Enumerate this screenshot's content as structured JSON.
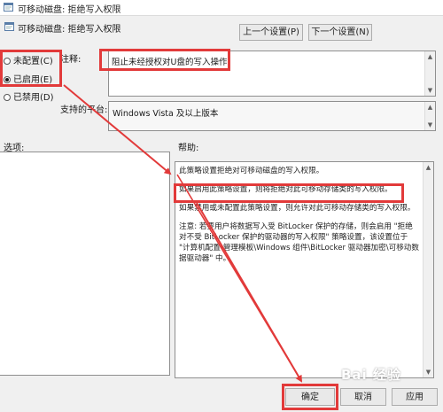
{
  "window": {
    "title": "可移动磁盘: 拒绝写入权限"
  },
  "header": {
    "setting_name": "可移动磁盘: 拒绝写入权限"
  },
  "nav": {
    "prev_label": "上一个设置(P)",
    "next_label": "下一个设置(N)"
  },
  "options": [
    {
      "label": "未配置(C)",
      "selected": false
    },
    {
      "label": "已启用(E)",
      "selected": true
    },
    {
      "label": "已禁用(D)",
      "selected": false
    }
  ],
  "comment": {
    "label": "注释:",
    "value": "阻止未经授权对U盘的写入操作！"
  },
  "supported": {
    "label": "支持的平台:",
    "value": "Windows Vista 及以上版本"
  },
  "sections": {
    "options_label": "选项:",
    "help_label": "帮助:"
  },
  "help": {
    "p1": "此策略设置拒绝对可移动磁盘的写入权限。",
    "p2": "如果启用此策略设置，则将拒绝对此可移动存储类的写入权限。",
    "p3": "如果禁用或未配置此策略设置，则允许对此可移动存储类的写入权限。",
    "p4": "注意: 若要用户将数据写入受 BitLocker 保护的存储，则会启用 \"拒绝对不受 BitLocker 保护的驱动器的写入权限\" 策略设置，该设置位于 \"计算机配置\\管理模板\\Windows 组件\\BitLocker 驱动器加密\\可移动数据驱动器\" 中。"
  },
  "footer": {
    "ok_label": "确定",
    "cancel_label": "取消",
    "apply_label": "应用"
  },
  "watermark": {
    "text": "Bai 经验"
  },
  "colors": {
    "highlight": "#e23a3a",
    "window_bg": "#f0f0f0"
  }
}
